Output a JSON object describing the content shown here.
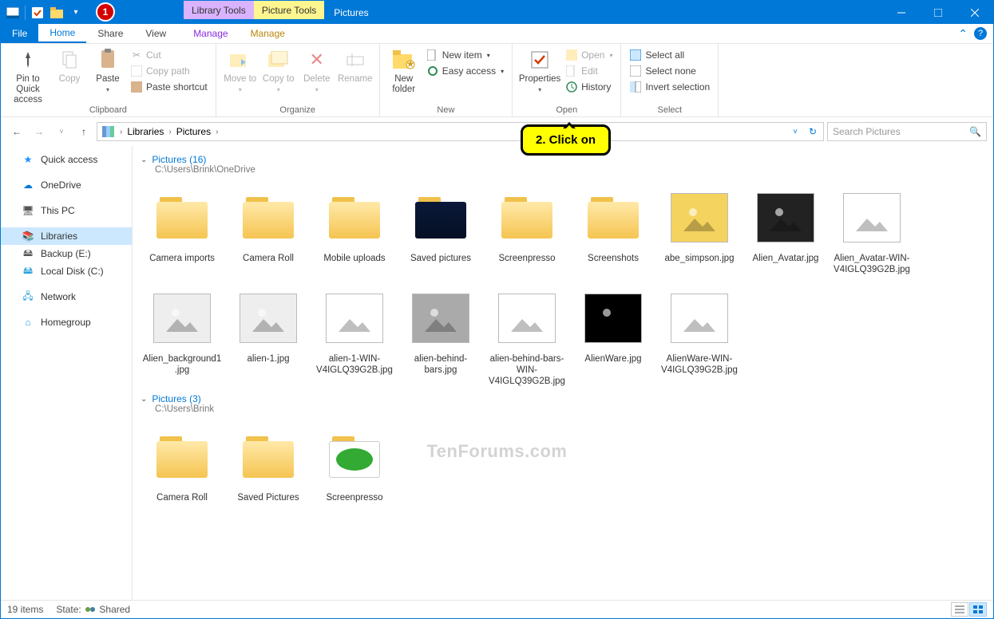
{
  "window": {
    "title": "Pictures"
  },
  "toolTabs": {
    "library": "Library Tools",
    "picture": "Picture Tools"
  },
  "tabs": {
    "file": "File",
    "home": "Home",
    "share": "Share",
    "view": "View",
    "manage1": "Manage",
    "manage2": "Manage"
  },
  "ribbon": {
    "clipboard": {
      "label": "Clipboard",
      "pin": "Pin to Quick access",
      "copy": "Copy",
      "paste": "Paste",
      "cut": "Cut",
      "copyPath": "Copy path",
      "pasteShortcut": "Paste shortcut"
    },
    "organize": {
      "label": "Organize",
      "moveTo": "Move to",
      "copyTo": "Copy to",
      "delete": "Delete",
      "rename": "Rename"
    },
    "new": {
      "label": "New",
      "newFolder": "New folder",
      "newItem": "New item",
      "easyAccess": "Easy access"
    },
    "open": {
      "label": "Open",
      "properties": "Properties",
      "open": "Open",
      "edit": "Edit",
      "history": "History"
    },
    "select": {
      "label": "Select",
      "all": "Select all",
      "none": "Select none",
      "invert": "Invert selection"
    }
  },
  "breadcrumb": {
    "root": "Libraries",
    "current": "Pictures"
  },
  "search": {
    "placeholder": "Search Pictures"
  },
  "sidebar": {
    "items": [
      {
        "label": "Quick access",
        "icon": "star",
        "color": "#1e90ff"
      },
      {
        "label": "OneDrive",
        "icon": "cloud",
        "color": "#0078d7"
      },
      {
        "label": "This PC",
        "icon": "pc",
        "color": "#555"
      },
      {
        "label": "Libraries",
        "icon": "lib",
        "color": "#2aa1da",
        "hot": true
      },
      {
        "label": "Backup (E:)",
        "icon": "drive",
        "color": "#555"
      },
      {
        "label": "Local Disk (C:)",
        "icon": "drive",
        "color": "#2aa1da"
      },
      {
        "label": "Network",
        "icon": "net",
        "color": "#2aa1da"
      },
      {
        "label": "Homegroup",
        "icon": "home",
        "color": "#2aa1da"
      }
    ]
  },
  "sections": [
    {
      "title": "Pictures (16)",
      "path": "C:\\Users\\Brink\\OneDrive",
      "items": [
        {
          "name": "Camera imports",
          "type": "folder"
        },
        {
          "name": "Camera Roll",
          "type": "folder"
        },
        {
          "name": "Mobile uploads",
          "type": "folder"
        },
        {
          "name": "Saved pictures",
          "type": "folder-dark"
        },
        {
          "name": "Screenpresso",
          "type": "folder"
        },
        {
          "name": "Screenshots",
          "type": "folder"
        },
        {
          "name": "abe_simpson.jpg",
          "type": "img",
          "bg": "#f4d35e"
        },
        {
          "name": "Alien_Avatar.jpg",
          "type": "img",
          "bg": "#222"
        },
        {
          "name": "Alien_Avatar-WIN-V4IGLQ39G2B.jpg",
          "type": "img",
          "bg": "#fff"
        },
        {
          "name": "Alien_background1.jpg",
          "type": "img",
          "bg": "#eee"
        },
        {
          "name": "alien-1.jpg",
          "type": "img",
          "bg": "#eee"
        },
        {
          "name": "alien-1-WIN-V4IGLQ39G2B.jpg",
          "type": "img",
          "bg": "#fff"
        },
        {
          "name": "alien-behind-bars.jpg",
          "type": "img",
          "bg": "#aaa"
        },
        {
          "name": "alien-behind-bars-WIN-V4IGLQ39G2B.jpg",
          "type": "img",
          "bg": "#fff"
        },
        {
          "name": "AlienWare.jpg",
          "type": "img",
          "bg": "#000"
        },
        {
          "name": "AlienWare-WIN-V4IGLQ39G2B.jpg",
          "type": "img",
          "bg": "#fff"
        }
      ]
    },
    {
      "title": "Pictures (3)",
      "path": "C:\\Users\\Brink",
      "items": [
        {
          "name": "Camera Roll",
          "type": "folder"
        },
        {
          "name": "Saved Pictures",
          "type": "folder"
        },
        {
          "name": "Screenpresso",
          "type": "folder-app"
        }
      ]
    }
  ],
  "status": {
    "count": "19 items",
    "state": "State:",
    "shared": "Shared"
  },
  "callouts": {
    "one": "1",
    "two": "2. Click on"
  },
  "watermark": "TenForums.com"
}
